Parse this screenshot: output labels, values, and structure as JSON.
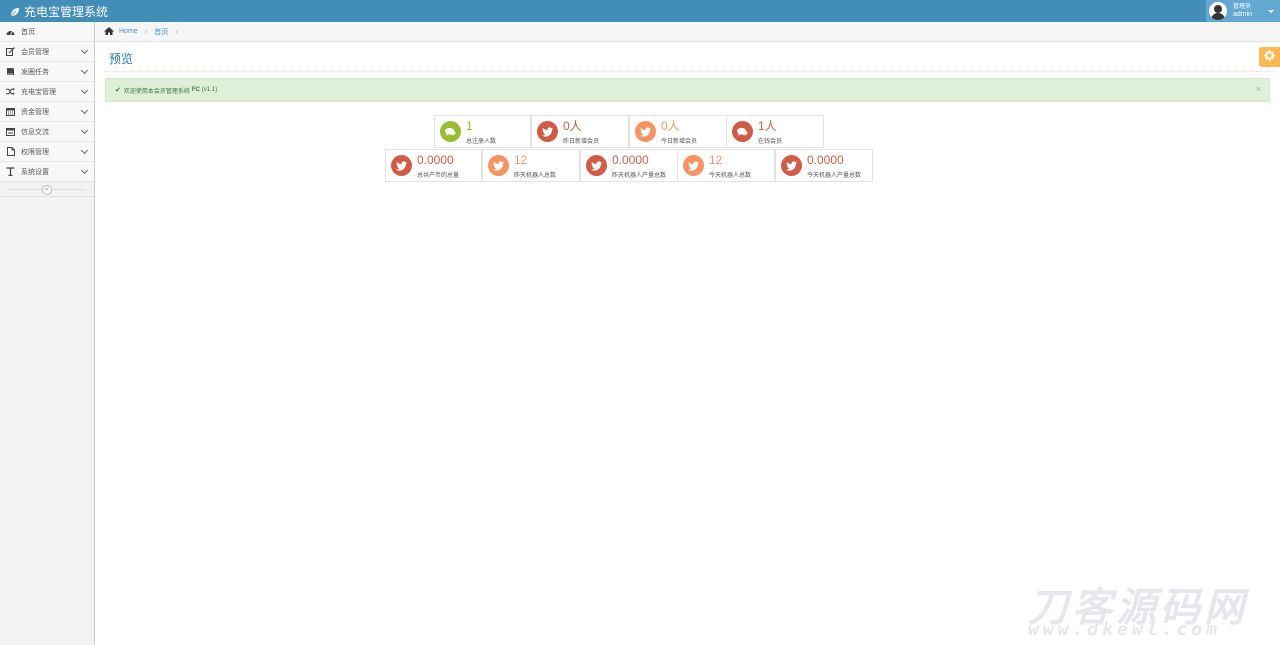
{
  "app": {
    "title": "充电宝管理系统"
  },
  "user": {
    "role": "管理员",
    "name": "admin"
  },
  "sidebar": {
    "items": [
      {
        "label": "首页",
        "icon": "dashboard-icon",
        "expandable": false
      },
      {
        "label": "会员管理",
        "icon": "edit-icon",
        "expandable": true
      },
      {
        "label": "发圈任务",
        "icon": "book-icon",
        "expandable": true
      },
      {
        "label": "充电宝管理",
        "icon": "random-icon",
        "expandable": true
      },
      {
        "label": "资金管理",
        "icon": "calendar-icon",
        "expandable": true
      },
      {
        "label": "信息交流",
        "icon": "card-icon",
        "expandable": true
      },
      {
        "label": "权限管理",
        "icon": "file-icon",
        "expandable": true
      },
      {
        "label": "系统设置",
        "icon": "text-icon",
        "expandable": true
      }
    ],
    "collapse_label": "«"
  },
  "breadcrumb": {
    "home": "Home",
    "current": "首页"
  },
  "page": {
    "title": "预览"
  },
  "alert": {
    "prefix": "欢迎使用本会员管理系统",
    "brand": "FC",
    "version": "(v1.1)",
    "close": "×"
  },
  "stats": [
    {
      "value": "1",
      "label": "总注册人数",
      "color": "#9abc32",
      "icon": "comments-icon"
    },
    {
      "value": "0人",
      "label": "昨日新增会员",
      "color": "#d15b47",
      "icon": "twitter-icon"
    },
    {
      "value": "0人",
      "label": "今日新增会员",
      "color": "#f79263",
      "icon": "twitter-icon"
    },
    {
      "value": "1人",
      "label": "在线会员",
      "color": "#d15b47",
      "icon": "comments-icon"
    },
    {
      "value": "0.0000",
      "label": "总共产币的总量",
      "color": "#d15b47",
      "icon": "twitter-icon"
    },
    {
      "value": "12",
      "label": "昨天机器人总数",
      "color": "#f79263",
      "icon": "twitter-icon"
    },
    {
      "value": "0.0000",
      "label": "昨天机器人产量总数",
      "color": "#d15b47",
      "icon": "twitter-icon"
    },
    {
      "value": "12",
      "label": "今天机器人总数",
      "color": "#f79263",
      "icon": "twitter-icon"
    },
    {
      "value": "0.0000",
      "label": "今天机器人产量总数",
      "color": "#d15b47",
      "icon": "twitter-icon"
    }
  ],
  "watermark": {
    "big": "刀客源码网",
    "small": "www.dkewl.com"
  }
}
